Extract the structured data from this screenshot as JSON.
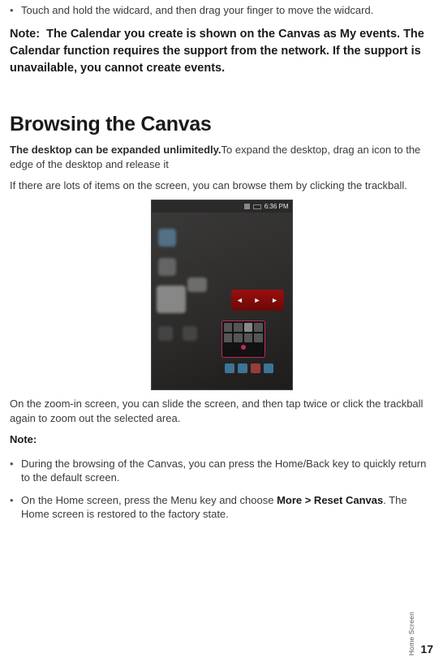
{
  "intro_bullet": "Touch and hold the widcard, and then drag your finger to move the widcard.",
  "note_label": "Note:",
  "note_text": "The Calendar you create is shown on the Canvas as My events. The Calendar function requires the support from the network. If the support is unavailable, you cannot create events.",
  "heading": "Browsing the Canvas",
  "para1_lead": "The desktop can be expanded unlimitedly.",
  "para1_rest": "To expand the desktop, drag an icon to the edge of the desktop and release it",
  "para2": "If there are lots of items on the screen, you can browse them by clicking the trackball.",
  "status_time": "6:36 PM",
  "para3": "On the zoom-in screen, you can slide the screen, and then tap twice or click the trackball again to zoom out the selected area.",
  "note2_label": "Note:",
  "bullet1": "During the browsing of the Canvas, you can press the Home/Back key to quickly return to the default screen.",
  "bullet2_a": "On the Home screen, press the Menu key and choose ",
  "bullet2_strong": "More > Reset Canvas",
  "bullet2_b": ". The Home screen is restored to the factory state.",
  "side_label": "Home Screen",
  "page_num": "17"
}
